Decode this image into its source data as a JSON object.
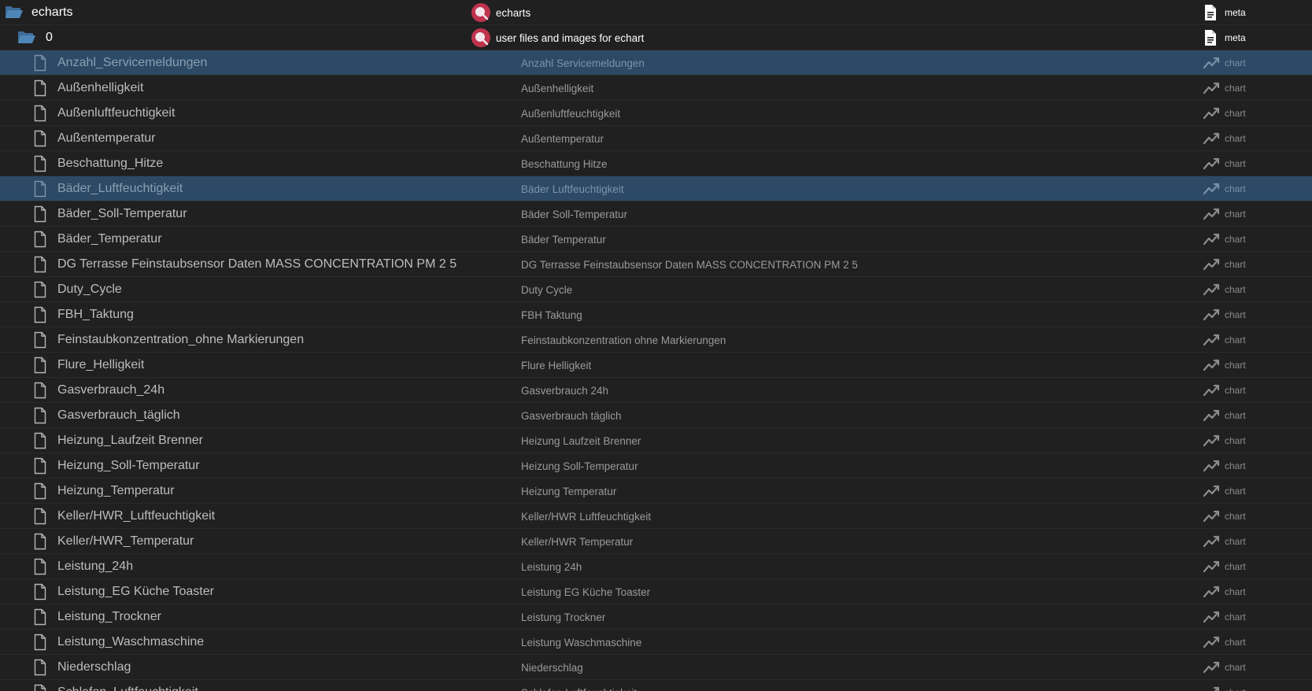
{
  "tree": {
    "folders": [
      {
        "name": "echarts",
        "description": "echarts",
        "action": "meta",
        "icon": "folder-open-icon",
        "adapter_icon": "echarts-adapter-icon",
        "action_icon": "document-icon"
      },
      {
        "name": "0",
        "description": "user files and images for echart",
        "action": "meta",
        "icon": "folder-open-icon",
        "adapter_icon": "echarts-adapter-icon",
        "action_icon": "document-icon"
      }
    ],
    "items": [
      {
        "name": "Anzahl_Servicemeldungen",
        "description": "Anzahl Servicemeldungen",
        "action": "chart",
        "selected": true
      },
      {
        "name": "Außenhelligkeit",
        "description": "Außenhelligkeit",
        "action": "chart"
      },
      {
        "name": "Außenluftfeuchtigkeit",
        "description": "Außenluftfeuchtigkeit",
        "action": "chart"
      },
      {
        "name": "Außentemperatur",
        "description": "Außentemperatur",
        "action": "chart"
      },
      {
        "name": "Beschattung_Hitze",
        "description": "Beschattung Hitze",
        "action": "chart"
      },
      {
        "name": "Bäder_Luftfeuchtigkeit",
        "description": "Bäder Luftfeuchtigkeit",
        "action": "chart",
        "selected": true
      },
      {
        "name": "Bäder_Soll-Temperatur",
        "description": "Bäder Soll-Temperatur",
        "action": "chart"
      },
      {
        "name": "Bäder_Temperatur",
        "description": "Bäder Temperatur",
        "action": "chart"
      },
      {
        "name": "DG Terrasse Feinstaubsensor Daten MASS CONCENTRATION PM 2 5",
        "description": "DG Terrasse Feinstaubsensor Daten MASS CONCENTRATION PM 2 5",
        "action": "chart"
      },
      {
        "name": "Duty_Cycle",
        "description": "Duty Cycle",
        "action": "chart"
      },
      {
        "name": "FBH_Taktung",
        "description": "FBH Taktung",
        "action": "chart"
      },
      {
        "name": "Feinstaubkonzentration_ohne Markierungen",
        "description": "Feinstaubkonzentration ohne Markierungen",
        "action": "chart"
      },
      {
        "name": "Flure_Helligkeit",
        "description": "Flure Helligkeit",
        "action": "chart"
      },
      {
        "name": "Gasverbrauch_24h",
        "description": "Gasverbrauch 24h",
        "action": "chart"
      },
      {
        "name": "Gasverbrauch_täglich",
        "description": "Gasverbrauch täglich",
        "action": "chart"
      },
      {
        "name": "Heizung_Laufzeit Brenner",
        "description": "Heizung Laufzeit Brenner",
        "action": "chart"
      },
      {
        "name": "Heizung_Soll-Temperatur",
        "description": "Heizung Soll-Temperatur",
        "action": "chart"
      },
      {
        "name": "Heizung_Temperatur",
        "description": "Heizung Temperatur",
        "action": "chart"
      },
      {
        "name": "Keller/HWR_Luftfeuchtigkeit",
        "description": "Keller/HWR Luftfeuchtigkeit",
        "action": "chart"
      },
      {
        "name": "Keller/HWR_Temperatur",
        "description": "Keller/HWR Temperatur",
        "action": "chart"
      },
      {
        "name": "Leistung_24h",
        "description": "Leistung 24h",
        "action": "chart"
      },
      {
        "name": "Leistung_EG Küche Toaster",
        "description": "Leistung EG Küche Toaster",
        "action": "chart"
      },
      {
        "name": "Leistung_Trockner",
        "description": "Leistung Trockner",
        "action": "chart"
      },
      {
        "name": "Leistung_Waschmaschine",
        "description": "Leistung Waschmaschine",
        "action": "chart"
      },
      {
        "name": "Niederschlag",
        "description": "Niederschlag",
        "action": "chart"
      },
      {
        "name": "Schlafen_Luftfeuchtigkeit",
        "description": "Schlafen Luftfeuchtigkeit",
        "action": "chart"
      }
    ],
    "item_icon": "file-icon",
    "item_action_icon": "line-chart-icon"
  },
  "colors": {
    "background": "#202020",
    "selected_row": "#2c4a66",
    "folder_icon": "#4f86b8",
    "adapter_icon": "#c0334d"
  }
}
